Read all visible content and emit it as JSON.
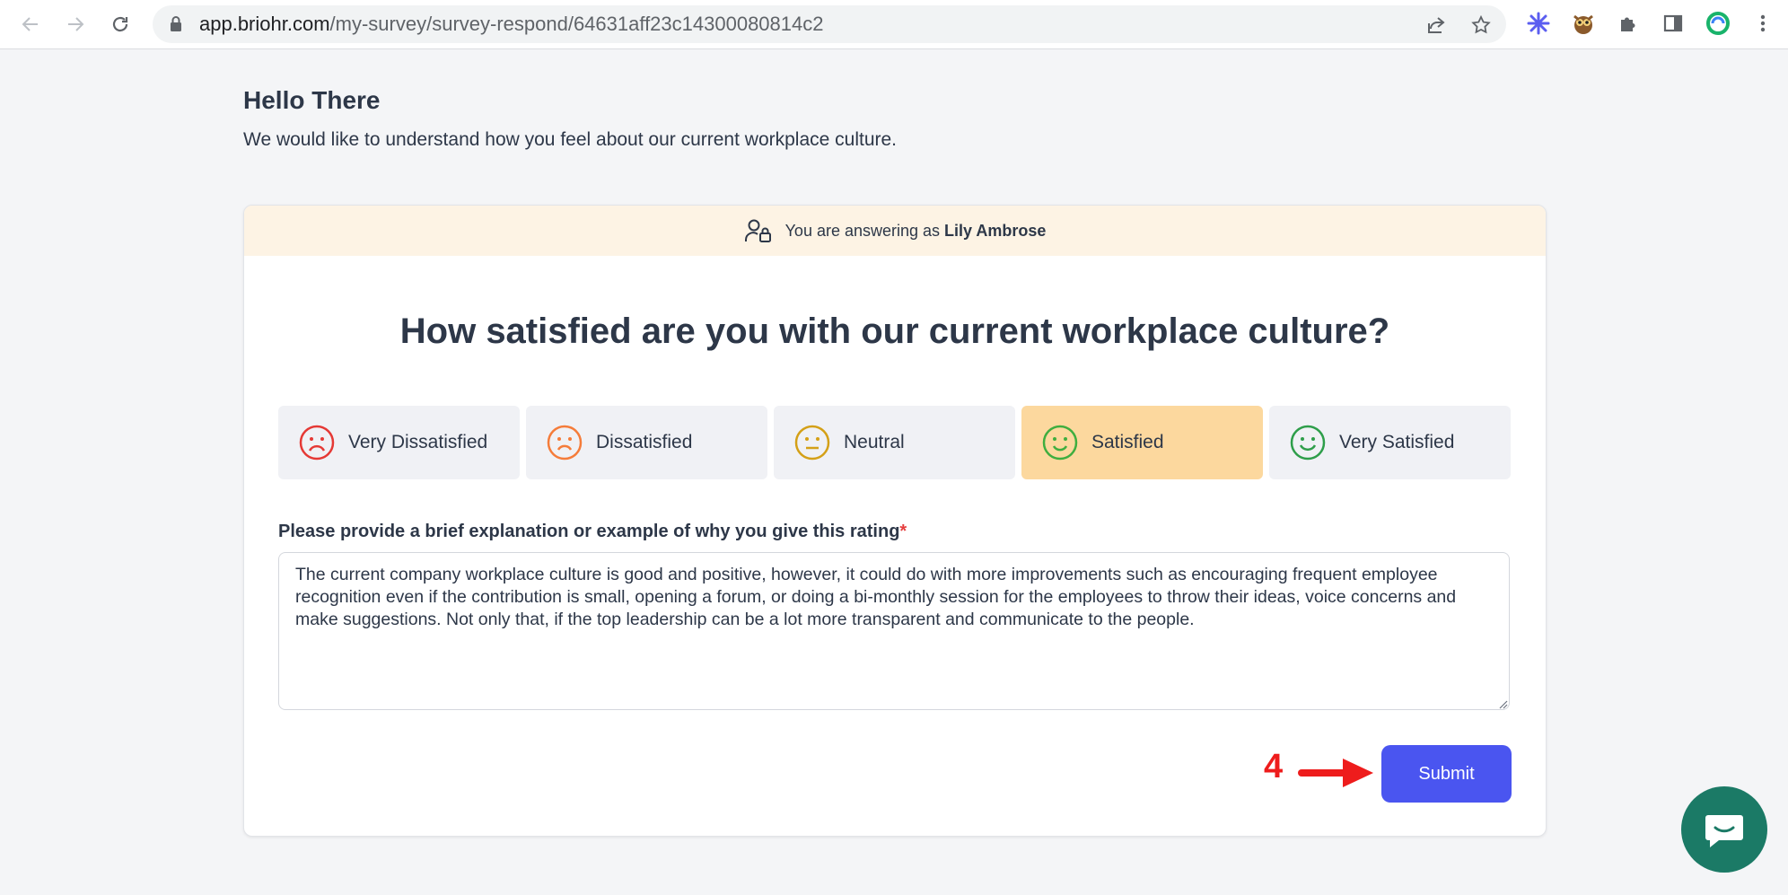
{
  "browser": {
    "url_host": "app.briohr.com",
    "url_path": "/my-survey/survey-respond/64631aff23c14300080814c2"
  },
  "page": {
    "greeting": "Hello There",
    "intro": "We would like to understand how you feel about our current workplace culture."
  },
  "banner": {
    "prefix": "You are answering as",
    "name": "Lily Ambrose"
  },
  "question": "How satisfied are you with our current workplace culture?",
  "options": [
    {
      "label": "Very Dissatisfied",
      "color": "#e53935",
      "selected": false
    },
    {
      "label": "Dissatisfied",
      "color": "#f57c3a",
      "selected": false
    },
    {
      "label": "Neutral",
      "color": "#d4a017",
      "selected": false
    },
    {
      "label": "Satisfied",
      "color": "#3fae3f",
      "selected": true
    },
    {
      "label": "Very Satisfied",
      "color": "#2e9e4a",
      "selected": false
    }
  ],
  "explanation": {
    "label": "Please provide a brief explanation or example of why you give this rating",
    "required_mark": "*",
    "value": "The current company workplace culture is good and positive, however, it could do with more improvements such as encouraging frequent employee recognition even if the contribution is small, opening a forum, or doing a bi-monthly session for the employees to throw their ideas, voice concerns and make suggestions. Not only that, if the top leadership can be a lot more transparent and communicate to the people."
  },
  "annotation": {
    "step": "4"
  },
  "submit_label": "Submit",
  "colors": {
    "accent": "#4a55f0",
    "selected_option": "#fcd89e",
    "banner": "#fdf3e4",
    "annotation": "#ee1c1c"
  }
}
